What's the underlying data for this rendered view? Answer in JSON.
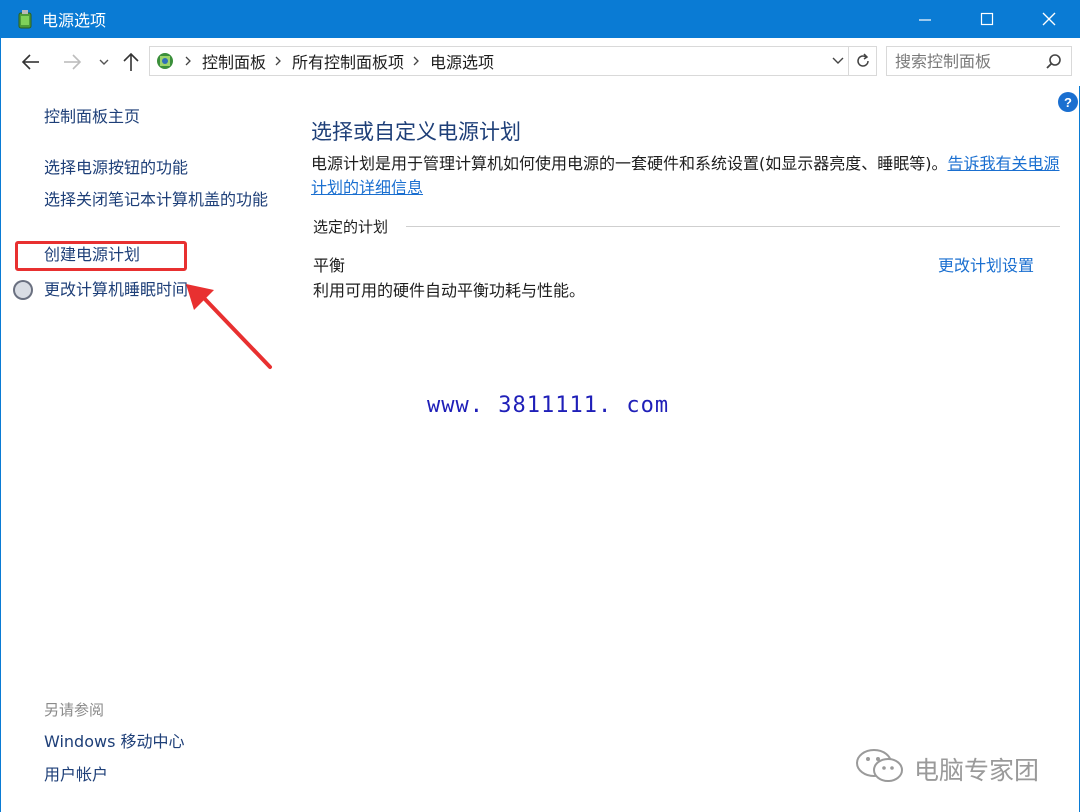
{
  "window": {
    "title": "电源选项",
    "controls": {
      "minimize": "minimize",
      "maximize": "maximize",
      "close": "close"
    }
  },
  "address_bar": {
    "breadcrumbs": [
      "控制面板",
      "所有控制面板项",
      "电源选项"
    ]
  },
  "search": {
    "placeholder": "搜索控制面板"
  },
  "left_pane": {
    "home": "控制面板主页",
    "links": [
      "选择电源按钮的功能",
      "选择关闭笔记本计算机盖的功能",
      "创建电源计划",
      "更改计算机睡眠时间"
    ],
    "see_also_heading": "另请参阅",
    "see_also_links": [
      "Windows 移动中心",
      "用户帐户"
    ]
  },
  "main": {
    "title": "选择或自定义电源计划",
    "description": "电源计划是用于管理计算机如何使用电源的一套硬件和系统设置(如显示器亮度、睡眠等)。",
    "more_info_link": "告诉我有关电源计划的详细信息",
    "selected_plan_label": "选定的计划",
    "plan": {
      "name": "平衡",
      "description": "利用可用的硬件自动平衡功耗与性能。",
      "change_link": "更改计划设置"
    }
  },
  "overlays": {
    "watermark_url": "www. 3811111. com",
    "brand": "电脑专家团"
  },
  "colors": {
    "titlebar": "#0a7bd4",
    "link": "#1a6fd0",
    "highlight": "#e83030"
  }
}
